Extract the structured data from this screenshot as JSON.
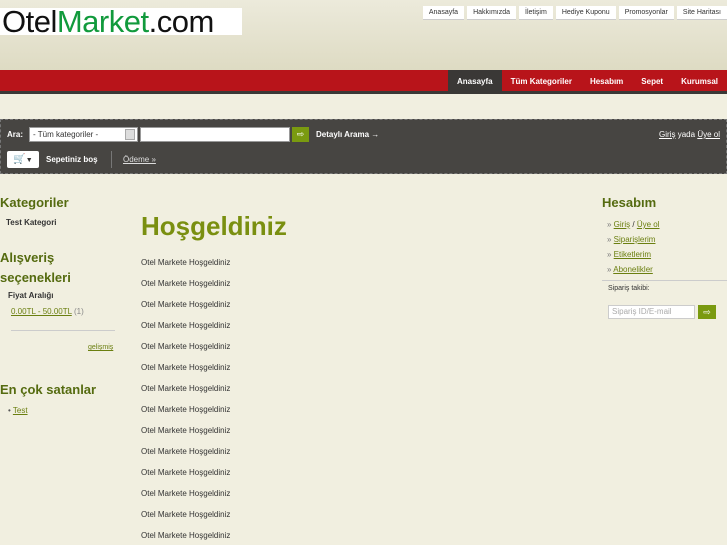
{
  "logo": {
    "part1": "Otel",
    "part2": "Market",
    "part3": ".com"
  },
  "top_links": [
    "Anasayfa",
    "Hakkımızda",
    "İletişim",
    "Hediye Kuponu",
    "Promosyonlar",
    "Site Haritası"
  ],
  "main_nav": [
    "Anasayfa",
    "Tüm Kategoriler",
    "Hesabım",
    "Sepet",
    "Kurumsal"
  ],
  "search": {
    "label": "Ara:",
    "category": "- Tüm kategoriler -",
    "go_icon": "arrow-right-icon",
    "advanced": "Detaylı Arama →",
    "login": "Giriş",
    "or": "yada",
    "register": "Üye ol"
  },
  "cart": {
    "status": "Sepetiniz boş",
    "checkout": "Ödeme »"
  },
  "left": {
    "categories_title": "Kategoriler",
    "categories": [
      "Test Kategori"
    ],
    "options_title": "Alışveriş seçenekleri",
    "price_title": "Fiyat Aralığı",
    "price_range": "0.00TL - 50.00TL",
    "price_count": "(1)",
    "advanced": "gelişmiş",
    "bestsellers_title": "En çok satanlar",
    "bestsellers": [
      "Test"
    ]
  },
  "main": {
    "title": "Hoşgeldiniz",
    "lines": [
      "Otel Markete Hoşgeldiniz",
      "Otel Markete Hoşgeldiniz",
      "Otel Markete Hoşgeldiniz",
      "Otel Markete Hoşgeldiniz",
      "Otel Markete Hoşgeldiniz",
      "Otel Markete Hoşgeldiniz",
      "Otel Markete Hoşgeldiniz",
      "Otel Markete Hoşgeldiniz",
      "Otel Markete Hoşgeldiniz",
      "Otel Markete Hoşgeldiniz",
      "Otel Markete Hoşgeldiniz",
      "Otel Markete Hoşgeldiniz",
      "Otel Markete Hoşgeldiniz",
      "Otel Markete Hoşgeldiniz"
    ]
  },
  "account": {
    "title": "Hesabım",
    "login": "Giriş",
    "sep": "/",
    "register": "Üye ol",
    "orders": "Siparişlerim",
    "tags": "Etiketlerim",
    "subscriptions": "Abonelikler",
    "track_label": "Sipariş takibi:",
    "track_placeholder": "Sipariş ID/E-mail"
  }
}
